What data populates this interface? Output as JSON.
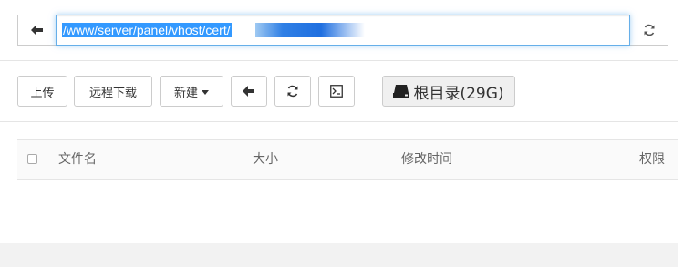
{
  "path_bar": {
    "path_value": "/www/server/panel/vhost/cert/",
    "back_icon": "arrow-left-icon",
    "refresh_icon": "refresh-icon"
  },
  "toolbar": {
    "upload_label": "上传",
    "remote_download_label": "远程下载",
    "new_label": "新建",
    "new_dropdown_icon": "caret-down-icon",
    "back_icon": "arrow-left-icon",
    "refresh_icon": "refresh-icon",
    "terminal_icon": "terminal-icon",
    "root_label": "根目录(29G)",
    "root_icon": "hdd-icon"
  },
  "table": {
    "columns": [
      "文件名",
      "大小",
      "修改时间",
      "权限"
    ]
  },
  "colors": {
    "selection": "#3399ff",
    "focus_border": "#66afe9",
    "border": "#cccccc",
    "divider": "#e5e5e5"
  }
}
